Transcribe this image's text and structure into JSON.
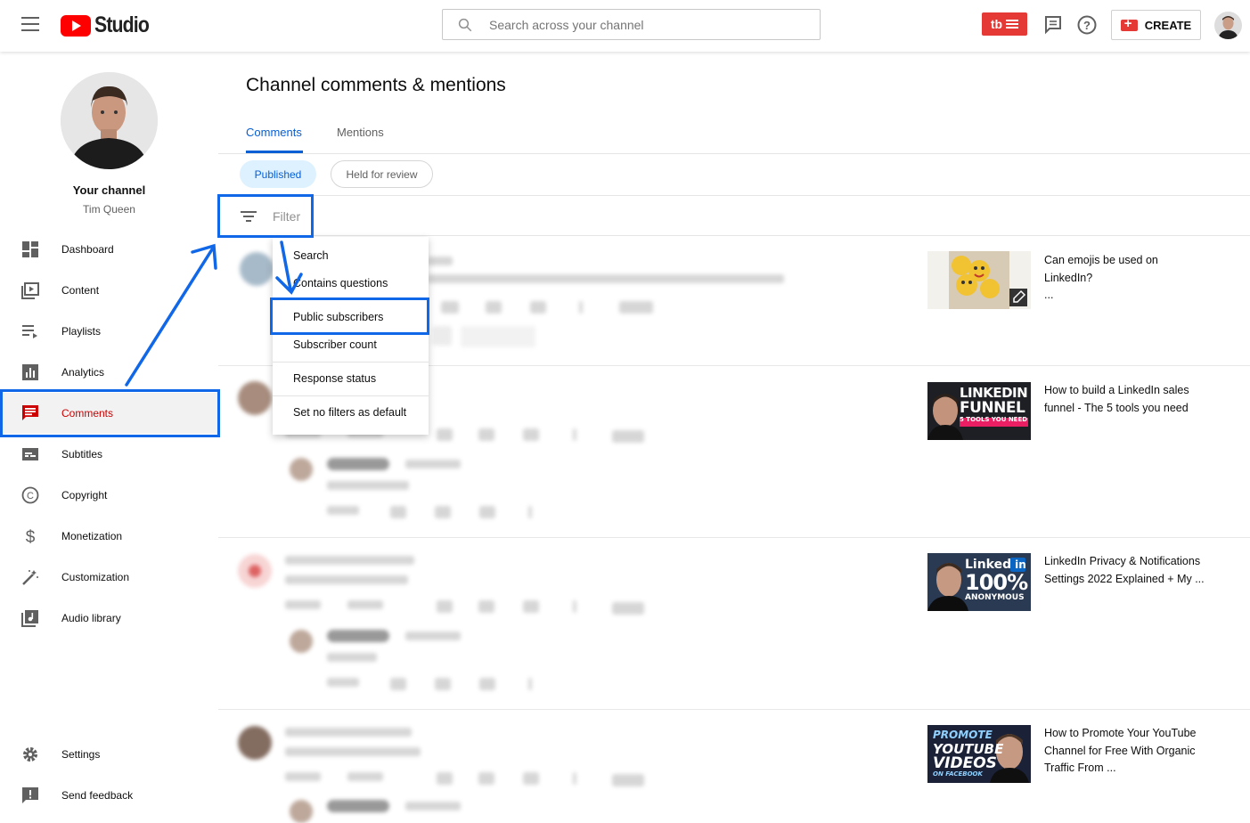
{
  "header": {
    "logo_text": "Studio",
    "search_placeholder": "Search across your channel",
    "badge_text": "tb",
    "create_label": "CREATE"
  },
  "sidebar": {
    "channel_title": "Your channel",
    "channel_name": "Tim Queen",
    "items": [
      {
        "label": "Dashboard",
        "icon": "dashboard-icon"
      },
      {
        "label": "Content",
        "icon": "content-icon"
      },
      {
        "label": "Playlists",
        "icon": "playlists-icon"
      },
      {
        "label": "Analytics",
        "icon": "analytics-icon"
      },
      {
        "label": "Comments",
        "icon": "comments-icon",
        "active": true
      },
      {
        "label": "Subtitles",
        "icon": "subtitles-icon"
      },
      {
        "label": "Copyright",
        "icon": "copyright-icon"
      },
      {
        "label": "Monetization",
        "icon": "monetization-icon"
      },
      {
        "label": "Customization",
        "icon": "customization-icon"
      },
      {
        "label": "Audio library",
        "icon": "audio-library-icon"
      }
    ],
    "bottom_items": [
      {
        "label": "Settings",
        "icon": "settings-icon"
      },
      {
        "label": "Send feedback",
        "icon": "feedback-icon"
      }
    ]
  },
  "main": {
    "title": "Channel comments & mentions",
    "tabs": [
      {
        "label": "Comments",
        "active": true
      },
      {
        "label": "Mentions",
        "active": false
      }
    ],
    "chips": [
      {
        "label": "Published",
        "selected": true
      },
      {
        "label": "Held for review",
        "selected": false
      }
    ],
    "filter_label": "Filter"
  },
  "dropdown": {
    "items": [
      {
        "label": "Search"
      },
      {
        "label": "Contains questions"
      },
      {
        "label": "Public subscribers",
        "highlighted": true
      },
      {
        "label": "Subscriber count"
      },
      {
        "label": "Response status"
      },
      {
        "label": "Set no filters as default"
      }
    ]
  },
  "videos": [
    {
      "title": "Can emojis be used on LinkedIn?",
      "extra": "..."
    },
    {
      "title": "How to build a LinkedIn sales funnel - The 5 tools you need",
      "thumb_text": [
        "LINKEDIN",
        "FUNNEL",
        "5 TOOLS YOU NEED"
      ]
    },
    {
      "title": "LinkedIn Privacy & Notifications Settings 2022 Explained + My ...",
      "thumb_text": [
        "Linked",
        "in",
        "100%",
        "ANONYMOUS"
      ]
    },
    {
      "title": "How to Promote Your YouTube Channel for Free With Organic Traffic From ...",
      "thumb_text": [
        "PROMOTE",
        "YOUTUBE",
        "VIDEOS",
        "ON FACEBOOK"
      ]
    }
  ],
  "colors": {
    "accent_blue": "#065fd4",
    "highlight_blue": "#1067e8",
    "active_red": "#cc0000",
    "brand_red": "#ff0000"
  }
}
